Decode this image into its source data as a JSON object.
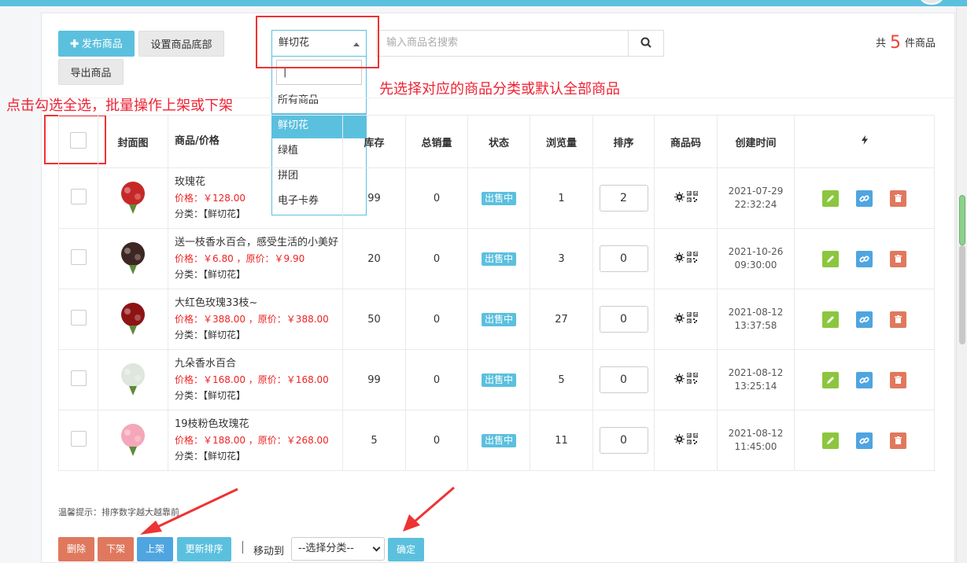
{
  "toolbar": {
    "publish_label": "发布商品",
    "bottom_label": "设置商品底部",
    "export_label": "导出商品",
    "category_selected": "鲜切花",
    "search_placeholder": "输入商品名搜索",
    "count_prefix": "共",
    "count_value": "5",
    "count_suffix": "件商品"
  },
  "dropdown": {
    "search_value": "|",
    "options": [
      "所有商品",
      "鲜切花",
      "绿植",
      "拼团",
      "电子卡券"
    ],
    "active_index": 1
  },
  "annotations": {
    "select_all": "点击勾选全选，批量操作上架或下架",
    "choose_category": "先选择对应的商品分类或默认全部商品"
  },
  "table": {
    "headers": [
      "封面图",
      "商品/价格",
      "库存",
      "总销量",
      "状态",
      "浏览量",
      "排序",
      "商品码",
      "创建时间"
    ],
    "rows": [
      {
        "name": "玫瑰花",
        "price": "价格：￥128.00",
        "category": "分类：【鲜切花】",
        "stock": "99",
        "sales": "0",
        "status": "出售中",
        "views": "1",
        "sort": "2",
        "date": "2021-07-29",
        "time": "22:32:24",
        "img_color": "#c62828"
      },
      {
        "name": "送一枝香水百合，感受生活的小美好",
        "price": "价格：￥6.80 ，原价：￥9.90",
        "category": "分类：【鲜切花】",
        "stock": "20",
        "sales": "0",
        "status": "出售中",
        "views": "3",
        "sort": "0",
        "date": "2021-10-26",
        "time": "09:30:00",
        "img_color": "#3e2723"
      },
      {
        "name": "大红色玫瑰33枝~",
        "price": "价格：￥388.00 ，原价：￥388.00",
        "category": "分类：【鲜切花】",
        "stock": "50",
        "sales": "0",
        "status": "出售中",
        "views": "27",
        "sort": "0",
        "date": "2021-08-12",
        "time": "13:37:58",
        "img_color": "#8e1414"
      },
      {
        "name": "九朵香水百合",
        "price": "价格：￥168.00 ，原价：￥168.00",
        "category": "分类：【鲜切花】",
        "stock": "99",
        "sales": "0",
        "status": "出售中",
        "views": "5",
        "sort": "0",
        "date": "2021-08-12",
        "time": "13:25:14",
        "img_color": "#dfe6dd"
      },
      {
        "name": "19枝粉色玫瑰花",
        "price": "价格：￥188.00 ，原价：￥268.00",
        "category": "分类：【鲜切花】",
        "stock": "5",
        "sales": "0",
        "status": "出售中",
        "views": "11",
        "sort": "0",
        "date": "2021-08-12",
        "time": "11:45:00",
        "img_color": "#f4a7b9"
      }
    ]
  },
  "footer": {
    "tip": "温馨提示：排序数字越大越靠前",
    "delete_label": "删除",
    "offshelf_label": "下架",
    "onshelf_label": "上架",
    "update_sort_label": "更新排序",
    "move_label": "移动到",
    "move_select": "--选择分类--",
    "confirm_label": "确定"
  }
}
